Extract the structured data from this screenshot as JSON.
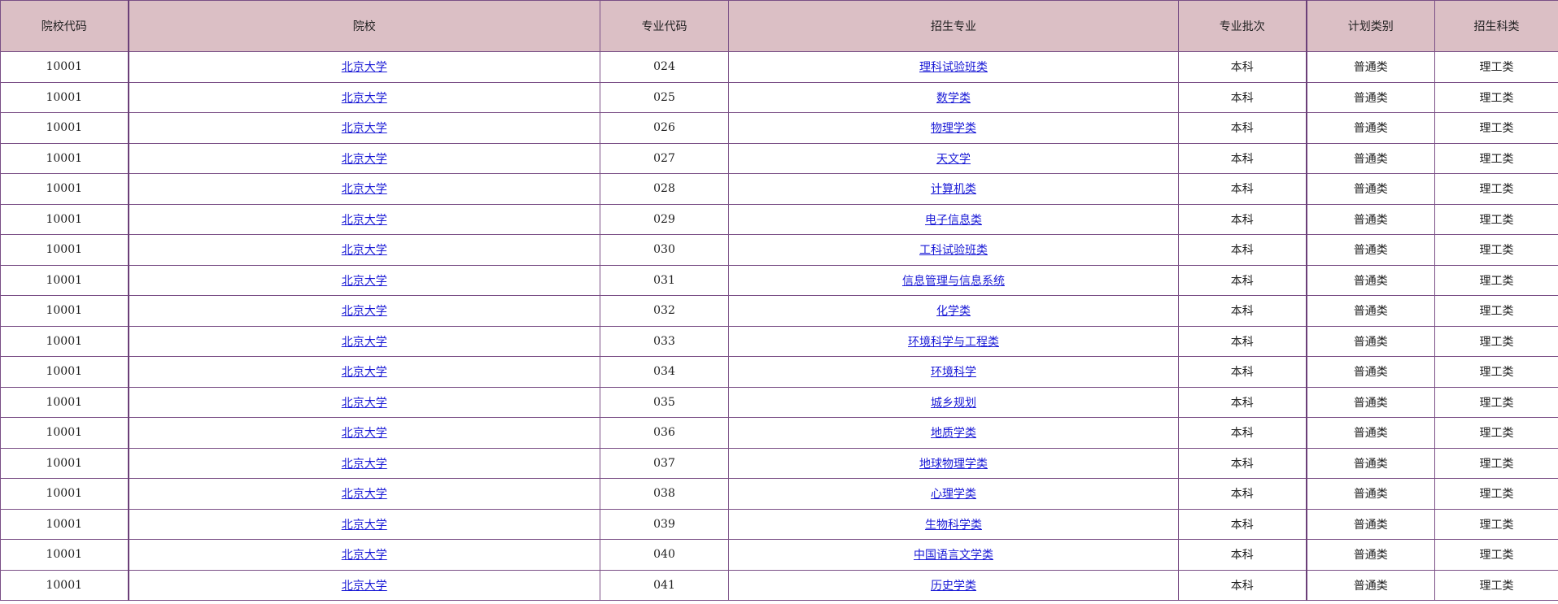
{
  "table": {
    "headers": [
      "院校代码",
      "院校",
      "专业代码",
      "招生专业",
      "专业批次",
      "计划类别",
      "招生科类"
    ],
    "rows": [
      [
        "10001",
        "北京大学",
        "024",
        "理科试验班类",
        "本科",
        "普通类",
        "理工类"
      ],
      [
        "10001",
        "北京大学",
        "025",
        "数学类",
        "本科",
        "普通类",
        "理工类"
      ],
      [
        "10001",
        "北京大学",
        "026",
        "物理学类",
        "本科",
        "普通类",
        "理工类"
      ],
      [
        "10001",
        "北京大学",
        "027",
        "天文学",
        "本科",
        "普通类",
        "理工类"
      ],
      [
        "10001",
        "北京大学",
        "028",
        "计算机类",
        "本科",
        "普通类",
        "理工类"
      ],
      [
        "10001",
        "北京大学",
        "029",
        "电子信息类",
        "本科",
        "普通类",
        "理工类"
      ],
      [
        "10001",
        "北京大学",
        "030",
        "工科试验班类",
        "本科",
        "普通类",
        "理工类"
      ],
      [
        "10001",
        "北京大学",
        "031",
        "信息管理与信息系统",
        "本科",
        "普通类",
        "理工类"
      ],
      [
        "10001",
        "北京大学",
        "032",
        "化学类",
        "本科",
        "普通类",
        "理工类"
      ],
      [
        "10001",
        "北京大学",
        "033",
        "环境科学与工程类",
        "本科",
        "普通类",
        "理工类"
      ],
      [
        "10001",
        "北京大学",
        "034",
        "环境科学",
        "本科",
        "普通类",
        "理工类"
      ],
      [
        "10001",
        "北京大学",
        "035",
        "城乡规划",
        "本科",
        "普通类",
        "理工类"
      ],
      [
        "10001",
        "北京大学",
        "036",
        "地质学类",
        "本科",
        "普通类",
        "理工类"
      ],
      [
        "10001",
        "北京大学",
        "037",
        "地球物理学类",
        "本科",
        "普通类",
        "理工类"
      ],
      [
        "10001",
        "北京大学",
        "038",
        "心理学类",
        "本科",
        "普通类",
        "理工类"
      ],
      [
        "10001",
        "北京大学",
        "039",
        "生物科学类",
        "本科",
        "普通类",
        "理工类"
      ],
      [
        "10001",
        "北京大学",
        "040",
        "中国语言文学类",
        "本科",
        "普通类",
        "理工类"
      ],
      [
        "10001",
        "北京大学",
        "041",
        "历史学类",
        "本科",
        "普通类",
        "理工类"
      ]
    ]
  },
  "colors": {
    "header_bg": "#dbbfc5",
    "border": "#7a4f86",
    "link": "#1a1ad6"
  }
}
